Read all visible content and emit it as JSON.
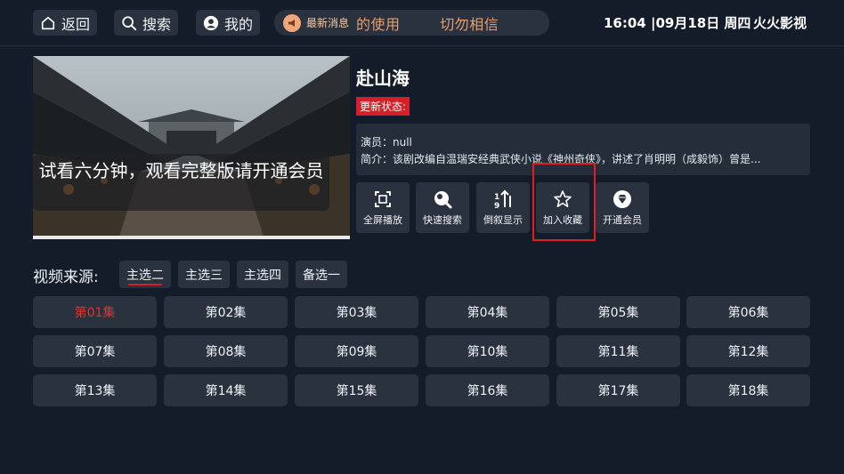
{
  "nav": {
    "back": "返回",
    "search": "搜索",
    "mine": "我的"
  },
  "news": {
    "label": "最新消息",
    "ticker": "的使用        切勿相信"
  },
  "header": {
    "clock": "16:04 |09月18日 周四",
    "brand": "火火影视"
  },
  "player": {
    "trial_notice": "试看六分钟，观看完整版请开通会员"
  },
  "detail": {
    "title": "赴山海",
    "status_label": "更新状态:",
    "actors": "演员：null",
    "summary": "简介：该剧改编自温瑞安经典武侠小说《神州奇侠》，讲述了肖明明（成毅饰）曾是..."
  },
  "actions": [
    {
      "label": "全屏播放",
      "icon": "fullscreen-icon"
    },
    {
      "label": "快速搜索",
      "icon": "quick-search-icon"
    },
    {
      "label": "倒叙显示",
      "icon": "reverse-order-icon"
    },
    {
      "label": "加入收藏",
      "icon": "star-icon"
    },
    {
      "label": "开通会员",
      "icon": "vip-diamond-icon"
    }
  ],
  "sources": {
    "title": "视频来源:",
    "items": [
      "主选二",
      "主选三",
      "主选四",
      "备选一"
    ],
    "selected": "主选二"
  },
  "episodes": {
    "items": [
      "第01集",
      "第02集",
      "第03集",
      "第04集",
      "第05集",
      "第06集",
      "第07集",
      "第08集",
      "第09集",
      "第10集",
      "第11集",
      "第12集",
      "第13集",
      "第14集",
      "第15集",
      "第16集",
      "第17集",
      "第18集"
    ],
    "active": "第01集"
  },
  "colors": {
    "background": "#141c29",
    "button": "#2a3240",
    "accent_red": "#d61f26",
    "news_orange": "#e39e70"
  }
}
